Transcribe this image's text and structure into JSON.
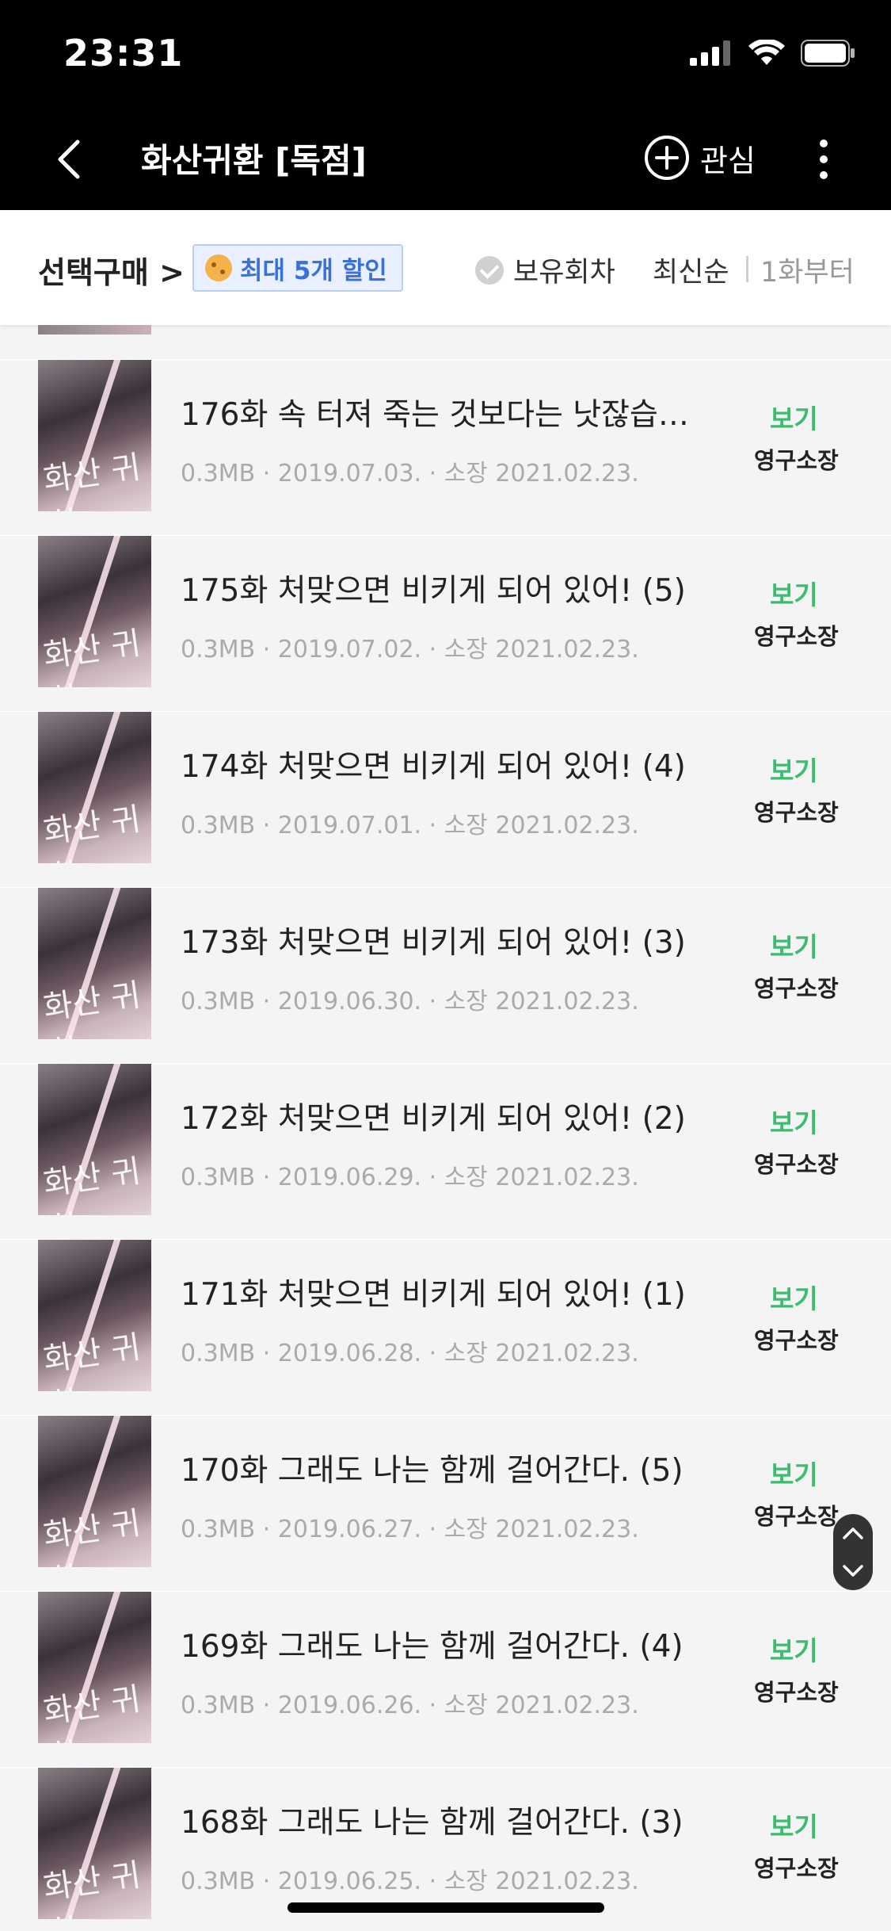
{
  "status_bar": {
    "time": "23:31"
  },
  "nav": {
    "title": "화산귀환 [독점]",
    "favorite_label": "관심"
  },
  "filter": {
    "select_buy": "선택구매 >",
    "discount_badge": "최대 5개 할인",
    "owned_label": "보유회차",
    "sort_newest": "최신순",
    "sort_separator": "|",
    "sort_from_first": "1화부터"
  },
  "thumb_text": "화산\n귀환",
  "episodes": [
    {
      "title": "176화 속 터져 죽는 것보다는 낫잖습…",
      "meta": "0.3MB · 2019.07.03. · 소장 2021.02.23.",
      "action": "보기",
      "ownership": "영구소장"
    },
    {
      "title": "175화 처맞으면 비키게 되어 있어! (5)",
      "meta": "0.3MB · 2019.07.02. · 소장 2021.02.23.",
      "action": "보기",
      "ownership": "영구소장"
    },
    {
      "title": "174화 처맞으면 비키게 되어 있어! (4)",
      "meta": "0.3MB · 2019.07.01. · 소장 2021.02.23.",
      "action": "보기",
      "ownership": "영구소장"
    },
    {
      "title": "173화 처맞으면 비키게 되어 있어! (3)",
      "meta": "0.3MB · 2019.06.30. · 소장 2021.02.23.",
      "action": "보기",
      "ownership": "영구소장"
    },
    {
      "title": "172화 처맞으면 비키게 되어 있어! (2)",
      "meta": "0.3MB · 2019.06.29. · 소장 2021.02.23.",
      "action": "보기",
      "ownership": "영구소장"
    },
    {
      "title": "171화 처맞으면 비키게 되어 있어! (1)",
      "meta": "0.3MB · 2019.06.28. · 소장 2021.02.23.",
      "action": "보기",
      "ownership": "영구소장"
    },
    {
      "title": "170화 그래도 나는 함께 걸어간다. (5)",
      "meta": "0.3MB · 2019.06.27. · 소장 2021.02.23.",
      "action": "보기",
      "ownership": "영구소장"
    },
    {
      "title": "169화 그래도 나는 함께 걸어간다. (4)",
      "meta": "0.3MB · 2019.06.26. · 소장 2021.02.23.",
      "action": "보기",
      "ownership": "영구소장"
    },
    {
      "title": "168화 그래도 나는 함께 걸어간다. (3)",
      "meta": "0.3MB · 2019.06.25. · 소장 2021.02.23.",
      "action": "보기",
      "ownership": "영구소장"
    }
  ],
  "colors": {
    "accent_green": "#3dbb6e",
    "badge_blue": "#3b6fd9"
  }
}
